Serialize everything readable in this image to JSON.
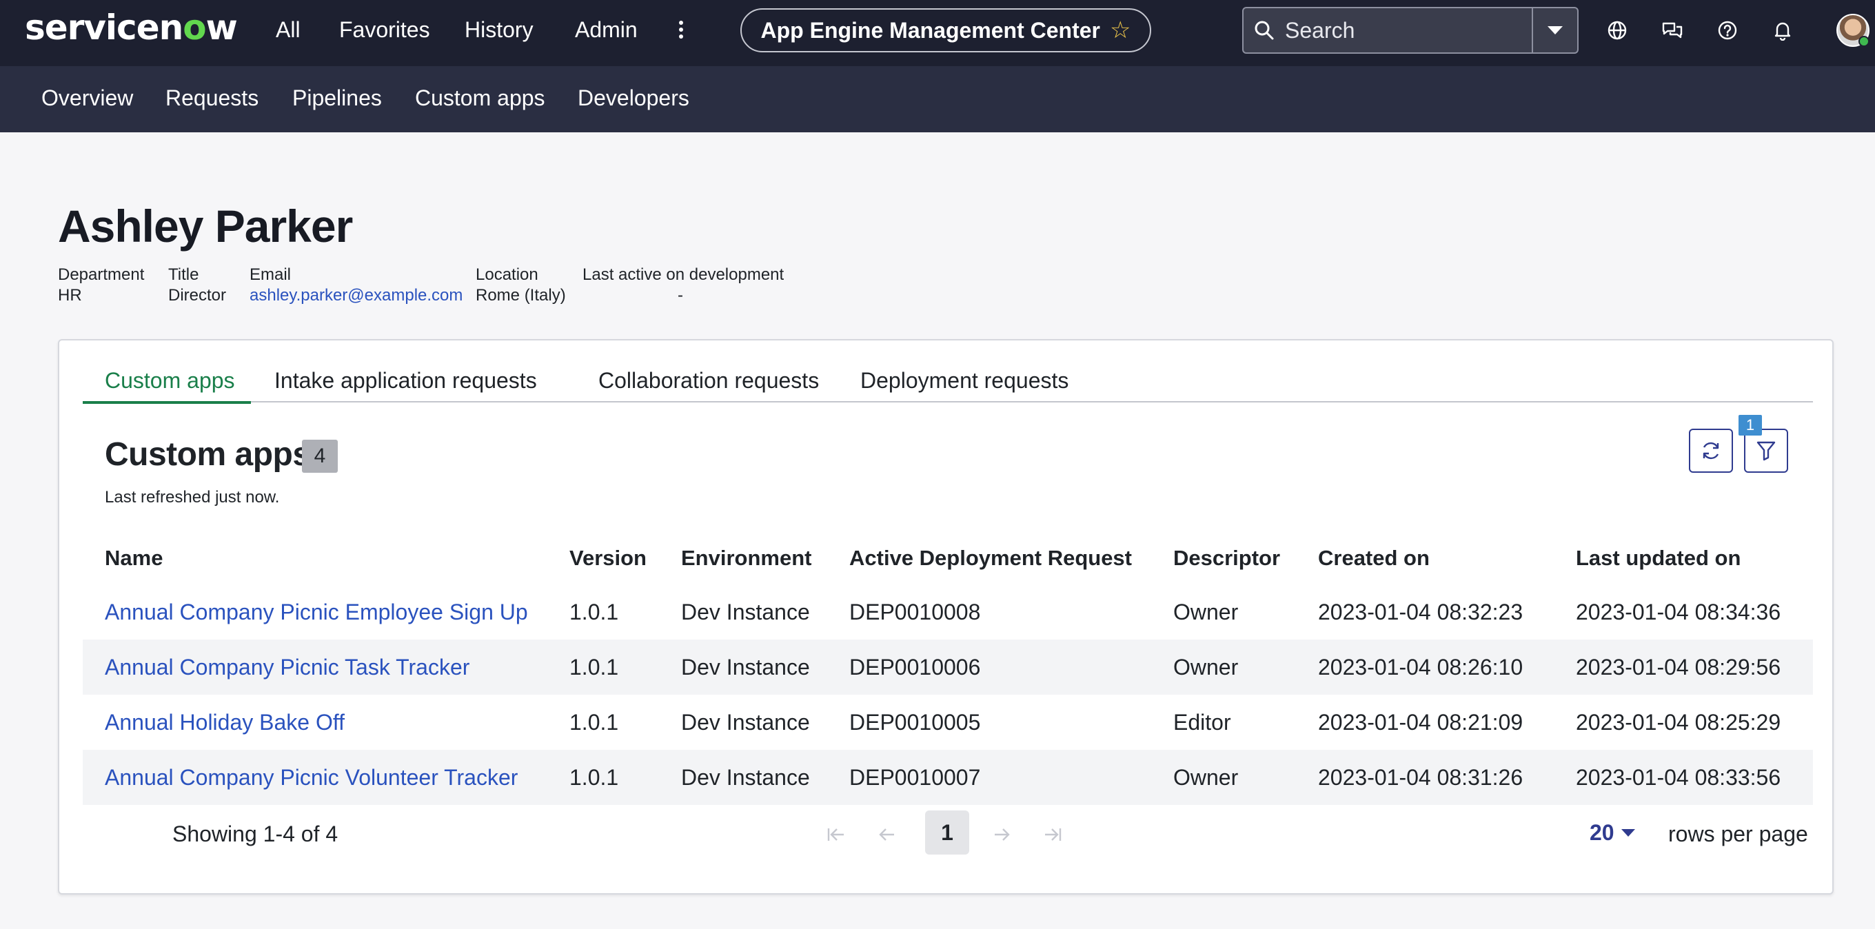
{
  "topbar": {
    "logo": "servicenow",
    "nav": [
      "All",
      "Favorites",
      "History",
      "Admin"
    ],
    "app_title": "App Engine Management Center",
    "search_label": "Search"
  },
  "subnav": [
    "Overview",
    "Requests",
    "Pipelines",
    "Custom apps",
    "Developers"
  ],
  "profile": {
    "name": "Ashley Parker",
    "fields": [
      {
        "label": "Department",
        "value": "HR"
      },
      {
        "label": "Title",
        "value": "Director"
      },
      {
        "label": "Email",
        "value": "ashley.parker@example.com"
      },
      {
        "label": "Location",
        "value": "Rome (Italy)"
      },
      {
        "label": "Last active on development",
        "value": "-"
      }
    ]
  },
  "tabs": [
    "Custom apps",
    "Intake application requests",
    "Collaboration requests",
    "Deployment requests"
  ],
  "custom_apps": {
    "title": "Custom apps",
    "count": "4",
    "refreshed": "Last refreshed just now.",
    "filter_count": "1",
    "columns": [
      "Name",
      "Version",
      "Environment",
      "Active Deployment Request",
      "Descriptor",
      "Created on",
      "Last updated on"
    ],
    "rows": [
      [
        "Annual Company Picnic Employee Sign Up",
        "1.0.1",
        "Dev Instance",
        "DEP0010008",
        "Owner",
        "2023-01-04 08:32:23",
        "2023-01-04 08:34:36"
      ],
      [
        "Annual Company Picnic Task Tracker",
        "1.0.1",
        "Dev Instance",
        "DEP0010006",
        "Owner",
        "2023-01-04 08:26:10",
        "2023-01-04 08:29:56"
      ],
      [
        "Annual Holiday Bake Off",
        "1.0.1",
        "Dev Instance",
        "DEP0010005",
        "Editor",
        "2023-01-04 08:21:09",
        "2023-01-04 08:25:29"
      ],
      [
        "Annual Company Picnic Volunteer Tracker",
        "1.0.1",
        "Dev Instance",
        "DEP0010007",
        "Owner",
        "2023-01-04 08:31:26",
        "2023-01-04 08:33:56"
      ]
    ]
  },
  "pagination": {
    "showing": "Showing 1-4 of 4",
    "current_page": "1",
    "rows_per_page": "20",
    "rows_label": "rows per page"
  }
}
